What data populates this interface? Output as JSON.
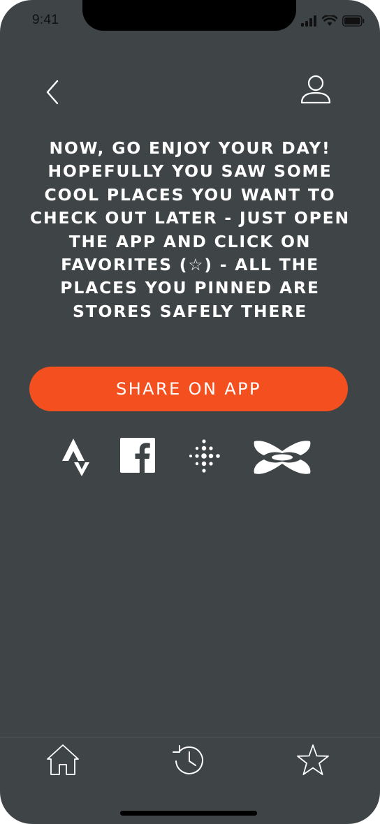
{
  "status_bar": {
    "time": "9:41"
  },
  "header": {
    "back_icon": "chevron-left-icon",
    "profile_icon": "user-profile-icon"
  },
  "message": "NOW, GO ENJOY YOUR DAY! HOPEFULLY YOU SAW SOME COOL PLACES YOU WANT TO CHECK OUT LATER - JUST OPEN THE APP AND CLICK ON FAVORITES (☆) - ALL THE PLACES YOU PINNED ARE STORES SAFELY THERE",
  "share_button": {
    "label": "SHARE ON APP",
    "color": "#f44f1f"
  },
  "social_icons": [
    "strava-icon",
    "facebook-icon",
    "fitbit-icon",
    "under-armour-icon"
  ],
  "tab_bar": {
    "items": [
      "home-icon",
      "history-icon",
      "favorites-star-icon"
    ]
  },
  "colors": {
    "background": "#3f4547",
    "accent": "#f44f1f",
    "text": "#ffffff"
  }
}
